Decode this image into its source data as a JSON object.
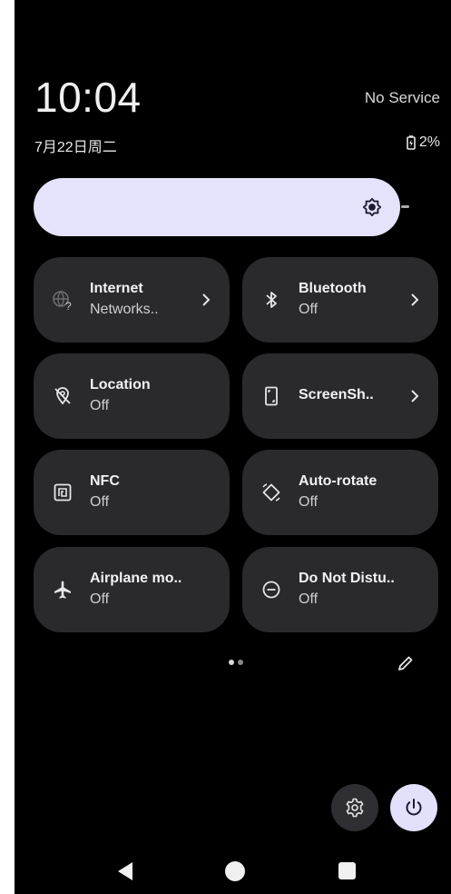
{
  "status": {
    "time": "10:04",
    "carrier": "No Service",
    "date": "7月22日周二",
    "battery": "2%"
  },
  "brightness": {
    "level": 0.88,
    "icon": "brightness-icon"
  },
  "tiles": [
    {
      "id": "internet",
      "label": "Internet",
      "state": "Networks..",
      "icon": "wifi-unknown-icon",
      "has_chevron": true
    },
    {
      "id": "bluetooth",
      "label": "Bluetooth",
      "state": "Off",
      "icon": "bluetooth-icon",
      "has_chevron": true
    },
    {
      "id": "location",
      "label": "Location",
      "state": "Off",
      "icon": "location-off-icon",
      "has_chevron": false
    },
    {
      "id": "screenshot",
      "label": "ScreenSh..",
      "state": "",
      "icon": "screenshot-icon",
      "has_chevron": true
    },
    {
      "id": "nfc",
      "label": "NFC",
      "state": "Off",
      "icon": "nfc-icon",
      "has_chevron": false
    },
    {
      "id": "autorotate",
      "label": "Auto-rotate",
      "state": "Off",
      "icon": "rotate-icon",
      "has_chevron": false
    },
    {
      "id": "airplane",
      "label": "Airplane mo..",
      "state": "Off",
      "icon": "airplane-icon",
      "has_chevron": false
    },
    {
      "id": "dnd",
      "label": "Do Not Distu..",
      "state": "Off",
      "icon": "do-not-disturb-icon",
      "has_chevron": false
    }
  ],
  "pager": {
    "pages": 2,
    "current": 1
  },
  "footer": {
    "settings_icon": "gear-icon",
    "power_icon": "power-icon",
    "edit_icon": "pencil-icon"
  },
  "nav": [
    "back-icon",
    "home-icon",
    "recents-icon"
  ],
  "colors": {
    "background": "#000000",
    "tile": "#2a2a2d",
    "brightness_fill": "#e5e3fb",
    "power_button": "#e2e0fb"
  }
}
